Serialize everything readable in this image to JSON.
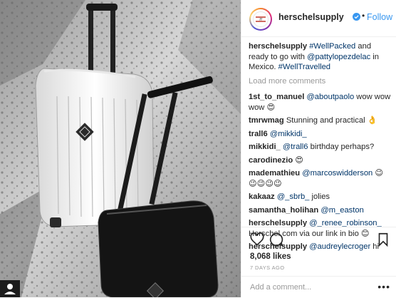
{
  "header": {
    "username": "herschelsupply",
    "follow_label": "Follow",
    "separator": "•"
  },
  "caption": {
    "username": "herschelsupply",
    "parts": [
      "#WellPacked",
      " and ready to go with ",
      "@pattylopezdelac",
      " in Mexico. ",
      "#WellTravelled"
    ]
  },
  "load_more": "Load more comments",
  "comments": [
    {
      "user": "1st_to_manuel",
      "mention": "@aboutpaolo",
      "text": " wow wow wow 😍"
    },
    {
      "user": "tmrwmag",
      "mention": "",
      "text": "Stunning and practical 👌"
    },
    {
      "user": "trall6",
      "mention": "@mikkidi_",
      "text": ""
    },
    {
      "user": "mikkidi_",
      "mention": "@trall6",
      "text": " birthday perhaps?"
    },
    {
      "user": "carodinezio",
      "mention": "",
      "text": "😍"
    },
    {
      "user": "mademathieu",
      "mention": "@marcoswidderson",
      "text": " 😉😉😉😉😉"
    },
    {
      "user": "kakaaz",
      "mention": "@_sbrb_",
      "text": " jolies"
    },
    {
      "user": "samantha_holihan",
      "mention": "@m_easton",
      "text": ""
    },
    {
      "user": "herschelsupply",
      "mention": "@_renee_robinson_",
      "text": " Herschel.com via our link in bio 😊"
    },
    {
      "user": "herschelsupply",
      "mention": "@audreylecroger",
      "text": " hi"
    }
  ],
  "likes": "8,068 likes",
  "timestamp": "7 DAYS AGO",
  "add_comment": {
    "placeholder": "Add a comment...",
    "more": "•••"
  },
  "icons": {
    "heart": "heart-icon",
    "comment": "comment-icon",
    "bookmark": "bookmark-icon",
    "verified": "verified-badge-icon"
  },
  "colors": {
    "link": "#3897f0",
    "mention": "#003569",
    "muted": "#999999",
    "text": "#262626"
  }
}
